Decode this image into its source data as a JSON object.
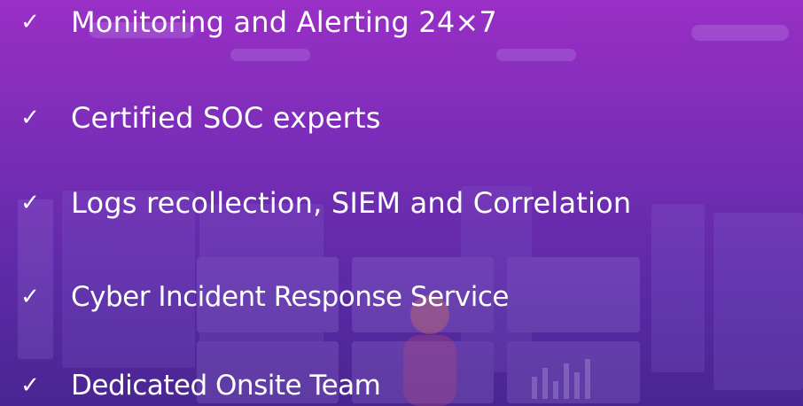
{
  "items": [
    {
      "check": "✓",
      "label": "Monitoring and Alerting 24×7"
    },
    {
      "check": "✓",
      "label": "Certified SOC experts"
    },
    {
      "check": "✓",
      "label": "Logs recollection, SIEM and Correlation"
    },
    {
      "check": "✓",
      "label": "Cyber Incident Response Service"
    },
    {
      "check": "✓",
      "label": "Dedicated Onsite Team"
    }
  ],
  "colors": {
    "background_top": "#9a2fc6",
    "background_bottom": "#4a2592",
    "text": "#ffffff"
  }
}
